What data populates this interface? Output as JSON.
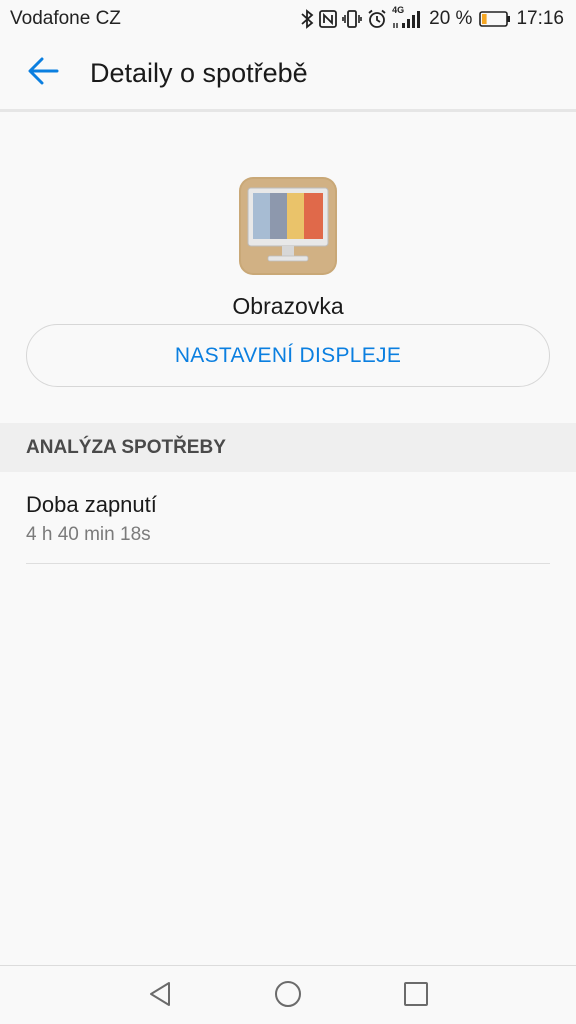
{
  "status_bar": {
    "carrier": "Vodafone CZ",
    "network": "4G",
    "battery_percent": "20 %",
    "battery_level": 0.2,
    "time": "17:16",
    "icons": [
      "bluetooth-icon",
      "nfc-icon",
      "vibrate-icon",
      "alarm-icon",
      "signal-icon",
      "battery-icon"
    ]
  },
  "header": {
    "title": "Detaily o spotřebě",
    "back_icon": "arrow-left-icon"
  },
  "app": {
    "name": "Obrazovka",
    "icon": "monitor-icon",
    "settings_button": "NASTAVENÍ DISPLEJE"
  },
  "analysis": {
    "section_title": "ANALÝZA SPOTŘEBY",
    "items": [
      {
        "label": "Doba zapnutí",
        "value": "4 h 40 min 18s"
      }
    ]
  },
  "nav": {
    "back_icon": "triangle-back-icon",
    "home_icon": "circle-home-icon",
    "recents_icon": "square-recents-icon"
  },
  "colors": {
    "accent": "#0b7fe0",
    "background": "#f9f9f9",
    "section_bg": "#efefef",
    "battery_low": "#f5a623"
  }
}
